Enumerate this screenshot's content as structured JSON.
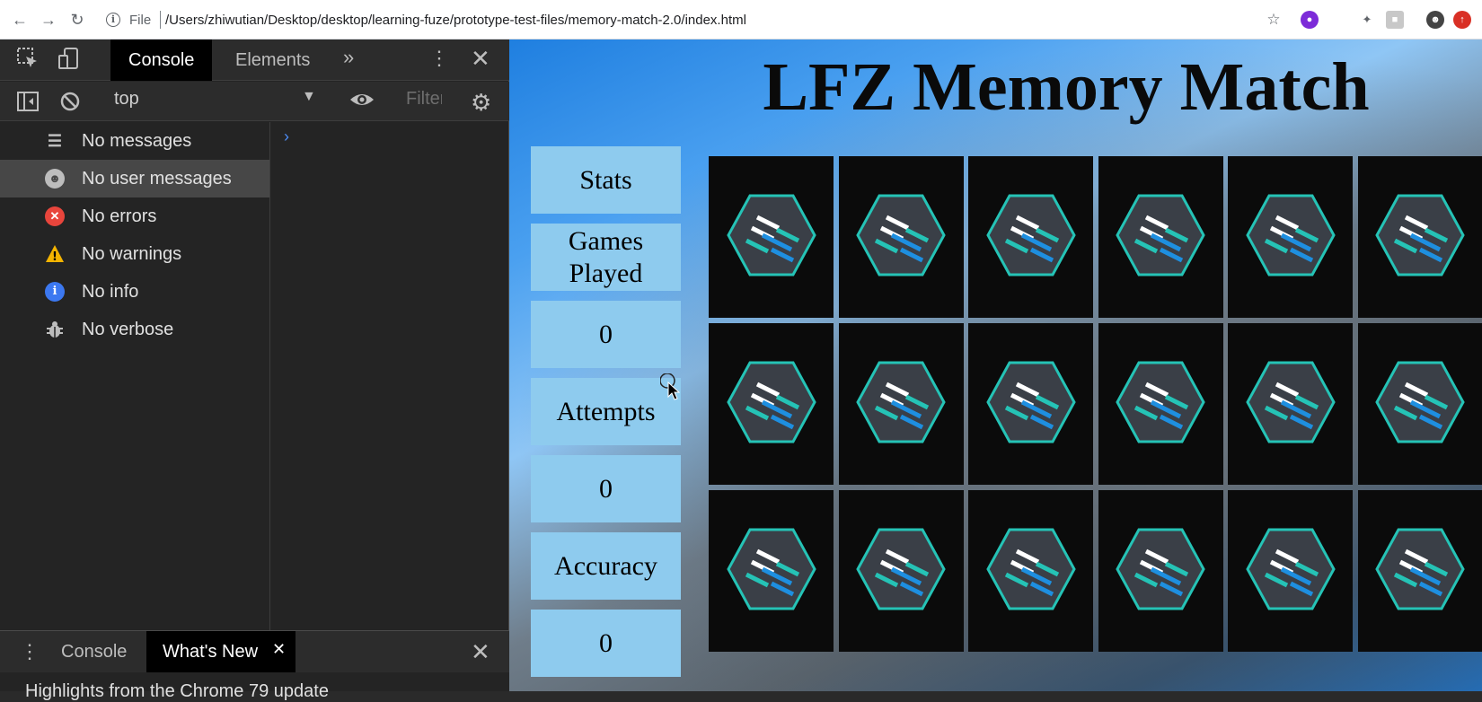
{
  "browser": {
    "file_label": "File",
    "url": "/Users/zhiwutian/Desktop/desktop/learning-fuze/prototype-test-files/memory-match-2.0/index.html"
  },
  "devtools": {
    "tabs": [
      "Console",
      "Elements"
    ],
    "context": "top",
    "filter_placeholder": "Filter",
    "sidebar": [
      {
        "label": "No messages",
        "icon": "list-icon",
        "color": "#bdbdbd"
      },
      {
        "label": "No user messages",
        "icon": "user-icon",
        "color": "#bdbdbd"
      },
      {
        "label": "No errors",
        "icon": "error-icon",
        "color": "#e8453c"
      },
      {
        "label": "No warnings",
        "icon": "warning-icon",
        "color": "#f4b400"
      },
      {
        "label": "No info",
        "icon": "info-icon",
        "color": "#3c78f0"
      },
      {
        "label": "No verbose",
        "icon": "bug-icon",
        "color": "#bdbdbd"
      }
    ],
    "drawer": {
      "tabs": [
        "Console",
        "What's New"
      ],
      "text": "Highlights from the Chrome 79 update"
    }
  },
  "game": {
    "title": "LFZ Memory Match",
    "stats": {
      "header": "Stats",
      "games_played_label": "Games Played",
      "games_played": "0",
      "attempts_label": "Attempts",
      "attempts": "0",
      "accuracy_label": "Accuracy",
      "accuracy": "0"
    },
    "card_rows": 3,
    "card_cols": 6,
    "card_back_icon": "lfz-hexagon-logo"
  }
}
